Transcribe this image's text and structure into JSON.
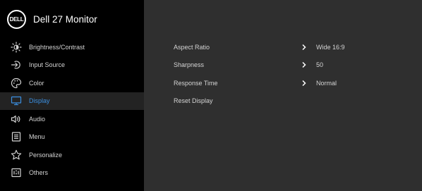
{
  "header": {
    "logo_text": "DELL",
    "title": "Dell 27 Monitor"
  },
  "sidebar": {
    "items": [
      {
        "label": "Brightness/Contrast",
        "icon": "brightness-icon"
      },
      {
        "label": "Input Source",
        "icon": "input-source-icon"
      },
      {
        "label": "Color",
        "icon": "color-palette-icon"
      },
      {
        "label": "Display",
        "icon": "display-icon",
        "active": true
      },
      {
        "label": "Audio",
        "icon": "speaker-icon"
      },
      {
        "label": "Menu",
        "icon": "menu-icon"
      },
      {
        "label": "Personalize",
        "icon": "star-icon"
      },
      {
        "label": "Others",
        "icon": "others-icon"
      }
    ]
  },
  "display_settings": {
    "rows": [
      {
        "label": "Aspect Ratio",
        "value": "Wide 16:9",
        "has_submenu": true
      },
      {
        "label": "Sharpness",
        "value": "50",
        "has_submenu": true
      },
      {
        "label": "Response Time",
        "value": "Normal",
        "has_submenu": true
      },
      {
        "label": "Reset Display",
        "value": "",
        "has_submenu": false
      }
    ]
  },
  "colors": {
    "accent": "#3b8fe0",
    "sidebar_bg": "#000000",
    "panel_bg": "#2f2f2f",
    "active_row_bg": "#232323",
    "text": "#d4d4d4"
  }
}
